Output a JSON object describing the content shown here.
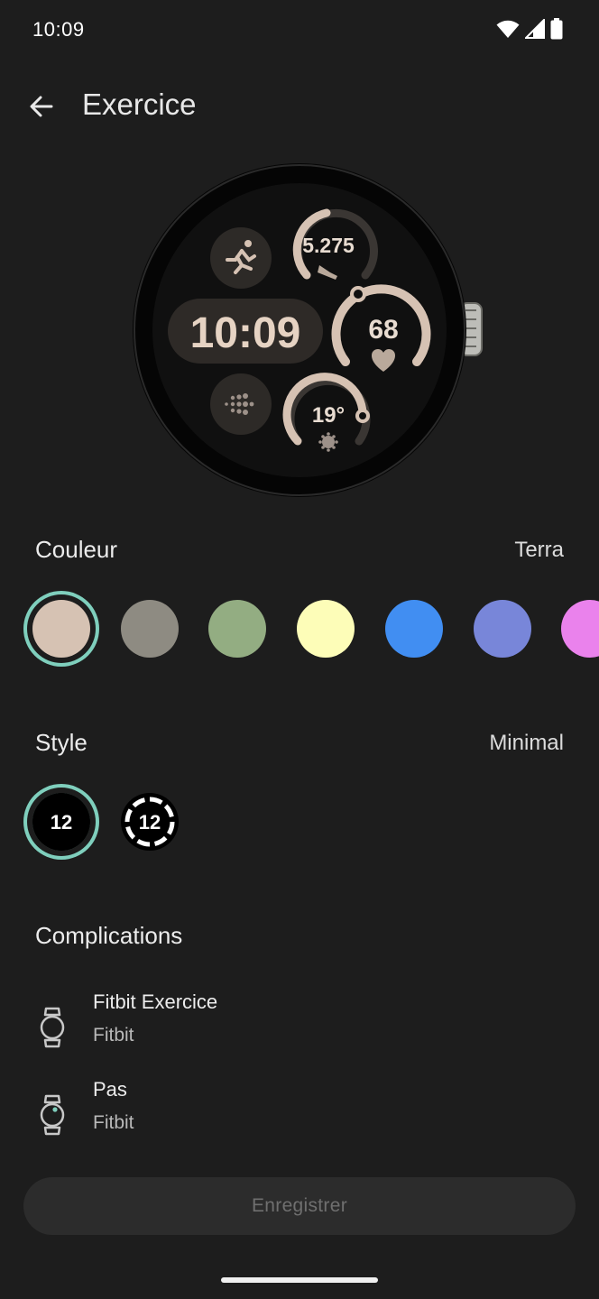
{
  "status_bar": {
    "time": "10:09",
    "icons": [
      "wifi-icon",
      "signal-icon",
      "battery-icon"
    ]
  },
  "header": {
    "title": "Exercice",
    "back_icon": "arrow-left-icon"
  },
  "watch_face": {
    "time": "10:09",
    "steps": "5.275",
    "heart_rate": "68",
    "temperature": "19°",
    "accent_color": "#d6c2b3"
  },
  "color_section": {
    "label": "Couleur",
    "value": "Terra",
    "swatches": [
      "#d6c2b3",
      "#8e8b82",
      "#93ad82",
      "#fdfdb8",
      "#418ef2",
      "#7886d9",
      "#ea82ec"
    ],
    "selected_index": 0
  },
  "style_section": {
    "label": "Style",
    "value": "Minimal",
    "options": [
      "12",
      "12"
    ],
    "selected_index": 0
  },
  "complications_section": {
    "label": "Complications",
    "items": [
      {
        "title": "Fitbit Exercice",
        "subtitle": "Fitbit",
        "icon": "watch-icon"
      },
      {
        "title": "Pas",
        "subtitle": "Fitbit",
        "icon": "watch-icon"
      }
    ]
  },
  "save_button": {
    "label": "Enregistrer"
  },
  "colors": {
    "background": "#1d1d1d",
    "selection_ring": "#7fcfbd",
    "button_bg": "#2c2c2c",
    "button_text_disabled": "#6f6f6f"
  }
}
